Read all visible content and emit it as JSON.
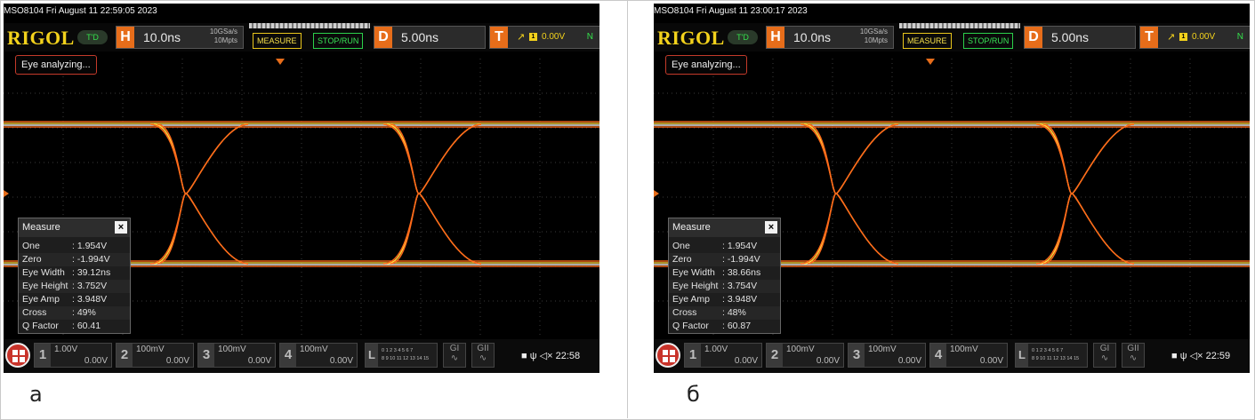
{
  "colors": {
    "brand": "#f3d21c",
    "horizontal_accent": "#e76d1a",
    "trace_orange": "#ff6a1a",
    "trace_yellow": "#ffd83a",
    "measure_button": "#f3d21c",
    "run_button": "#35e04c",
    "background": "#000000"
  },
  "panels": [
    {
      "letter": "а",
      "status": "MSO8104  Fri August 11 22:59:05 2023",
      "brand": "RIGOL",
      "td_badge": "T'D",
      "horizontal": {
        "letter": "H",
        "timebase": "10.0ns",
        "sample_rate": "10GSa/s",
        "memory_depth": "10Mpts"
      },
      "buttons": {
        "measure": "MEASURE",
        "stop_run": "STOP/RUN"
      },
      "delay": {
        "letter": "D",
        "value": "5.00ns"
      },
      "trigger": {
        "letter": "T",
        "source": "1",
        "level": "0.00V",
        "mode": "N"
      },
      "eye_message": "Eye analyzing...",
      "measure": {
        "title": "Measure",
        "close": "×",
        "rows": [
          {
            "label": "One",
            "value": ": 1.954V"
          },
          {
            "label": "Zero",
            "value": ": -1.994V"
          },
          {
            "label": "Eye Width",
            "value": ": 39.12ns"
          },
          {
            "label": "Eye Height",
            "value": ": 3.752V"
          },
          {
            "label": "Eye Amp",
            "value": ": 3.948V"
          },
          {
            "label": "Cross",
            "value": ": 49%"
          },
          {
            "label": "Q Factor",
            "value": ": 60.41"
          }
        ]
      },
      "channels": [
        {
          "num": "1",
          "scale": "1.00V",
          "offset": "0.00V"
        },
        {
          "num": "2",
          "scale": "100mV",
          "offset": "0.00V"
        },
        {
          "num": "3",
          "scale": "100mV",
          "offset": "0.00V"
        },
        {
          "num": "4",
          "scale": "100mV",
          "offset": "0.00V"
        }
      ],
      "logic": {
        "label": "L",
        "row1": "0 1 2 3  4 5 6 7",
        "row2": "8 9 10 11 12 13 14 15"
      },
      "gen": {
        "g1": "GI",
        "g2": "GII"
      },
      "clock": "22:58",
      "cross_percent": 49
    },
    {
      "letter": "б",
      "status": "MSO8104  Fri August 11 23:00:17 2023",
      "brand": "RIGOL",
      "td_badge": "T'D",
      "horizontal": {
        "letter": "H",
        "timebase": "10.0ns",
        "sample_rate": "10GSa/s",
        "memory_depth": "10Mpts"
      },
      "buttons": {
        "measure": "MEASURE",
        "stop_run": "STOP/RUN"
      },
      "delay": {
        "letter": "D",
        "value": "5.00ns"
      },
      "trigger": {
        "letter": "T",
        "source": "1",
        "level": "0.00V",
        "mode": "N"
      },
      "eye_message": "Eye analyzing...",
      "measure": {
        "title": "Measure",
        "close": "×",
        "rows": [
          {
            "label": "One",
            "value": ": 1.954V"
          },
          {
            "label": "Zero",
            "value": ": -1.994V"
          },
          {
            "label": "Eye Width",
            "value": ": 38.66ns"
          },
          {
            "label": "Eye Height",
            "value": ": 3.754V"
          },
          {
            "label": "Eye Amp",
            "value": ": 3.948V"
          },
          {
            "label": "Cross",
            "value": ": 48%"
          },
          {
            "label": "Q Factor",
            "value": ": 60.87"
          }
        ]
      },
      "channels": [
        {
          "num": "1",
          "scale": "1.00V",
          "offset": "0.00V"
        },
        {
          "num": "2",
          "scale": "100mV",
          "offset": "0.00V"
        },
        {
          "num": "3",
          "scale": "100mV",
          "offset": "0.00V"
        },
        {
          "num": "4",
          "scale": "100mV",
          "offset": "0.00V"
        }
      ],
      "logic": {
        "label": "L",
        "row1": "0 1 2 3  4 5 6 7",
        "row2": "8 9 10 11 12 13 14 15"
      },
      "gen": {
        "g1": "GI",
        "g2": "GII"
      },
      "clock": "22:59",
      "cross_percent": 48
    }
  ]
}
